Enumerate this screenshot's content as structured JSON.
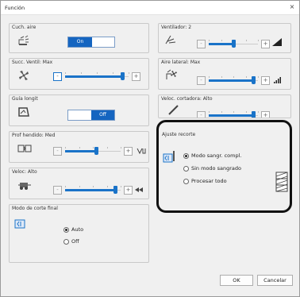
{
  "window": {
    "title": "Función",
    "close_glyph": "×"
  },
  "groups": {
    "cuch_aire": {
      "label": "Cuch. aire",
      "toggle_on_label": "On"
    },
    "succ_ventil": {
      "label": "Succ. Ventil: Max"
    },
    "guia_longit": {
      "label": "Guía longit",
      "toggle_on_label": "Off"
    },
    "prof_hendido": {
      "label": "Prof hendido: Med"
    },
    "veloc": {
      "label": "Veloc: Alto"
    },
    "modo_corte_final": {
      "label": "Modo de corte final",
      "options": [
        {
          "label": "Auto",
          "selected": true
        },
        {
          "label": "Off",
          "selected": false
        }
      ]
    },
    "ventilador": {
      "label": "Ventilador: 2"
    },
    "aire_lateral": {
      "label": "Aire lateral: Max"
    },
    "veloc_cortadora": {
      "label": "Veloc. cortadora: Alto"
    },
    "ajuste_recorte": {
      "label": "Ajuste recorte",
      "options": [
        {
          "label": "Modo sangr. compl.",
          "selected": true
        },
        {
          "label": "Sin modo sangrado",
          "selected": false
        },
        {
          "label": "Procesar todo",
          "selected": false
        }
      ]
    }
  },
  "slider_levels": {
    "succ_ventil": 0.9,
    "prof_hendido": 0.55,
    "veloc": 0.9,
    "ventilador": 0.5,
    "aire_lateral": 0.9,
    "veloc_cortadora": 0.9
  },
  "buttons": {
    "ok": "OK",
    "cancel": "Cancelar"
  },
  "colors": {
    "accent": "#1a73c8",
    "toggle_on": "#1565c0"
  }
}
